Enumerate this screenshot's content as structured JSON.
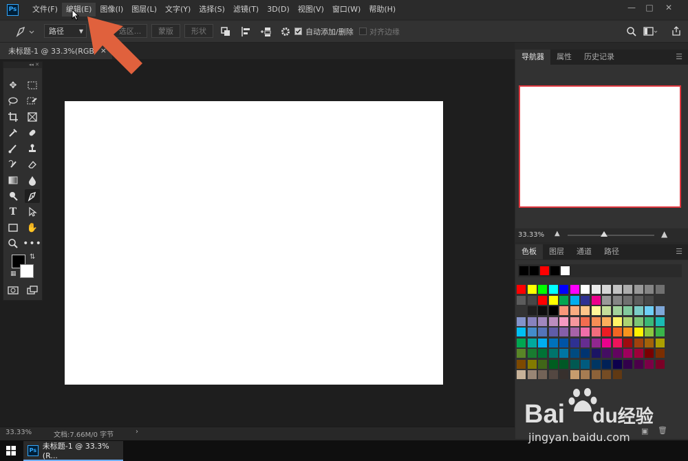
{
  "app": {
    "logo": "Ps"
  },
  "menu": [
    "文件(F)",
    "编辑(E)",
    "图像(I)",
    "图层(L)",
    "文字(Y)",
    "选择(S)",
    "滤镜(T)",
    "3D(D)",
    "视图(V)",
    "窗口(W)",
    "帮助(H)"
  ],
  "options": {
    "pen_mode": "路径",
    "make_selection": "选区...",
    "mask": "蒙版",
    "shape": "形状",
    "auto_add_delete": "自动添加/删除",
    "align_edges": "对齐边缘"
  },
  "document": {
    "tab_title": "未标题-1 @ 33.3%(RGB",
    "close": "×",
    "zoom": "33.33%",
    "doc_info": "文档:7.66M/0 字节",
    "status_arrow": "›"
  },
  "navigator": {
    "tabs": [
      "导航器",
      "属性",
      "历史记录"
    ],
    "zoom": "33.33%"
  },
  "swatches_panel": {
    "tabs": [
      "色板",
      "图层",
      "通道",
      "路径"
    ],
    "recent": [
      "#000000",
      "#000000",
      "#ff0000",
      "#000000",
      "#ffffff"
    ],
    "grid": [
      [
        "#ff0000",
        "#ffff00",
        "#00ff00",
        "#00ffff",
        "#0000ff",
        "#ff00ff",
        "#ffffff",
        "#ebebeb",
        "#d6d6d6",
        "#c2c2c2",
        "#adadad",
        "#999999",
        "#858585",
        "#707070"
      ],
      [
        "#5c5c5c",
        "#474747",
        "#ff0000",
        "#ffff00",
        "#00a651",
        "#00aeef",
        "#2e3192",
        "#ec008c",
        "#999999",
        "#858585",
        "#707070",
        "#5c5c5c",
        "#474747",
        "#333333"
      ],
      [
        "#333333",
        "#1f1f1f",
        "#0d0d0d",
        "#000000",
        "#f7977a",
        "#f9ad81",
        "#fdc68a",
        "#fff79a",
        "#c4df9b",
        "#a3d39c",
        "#82ca9d",
        "#7bcdc8",
        "#6ecff6",
        "#7ea7d8"
      ],
      [
        "#8493ca",
        "#8882be",
        "#a187be",
        "#bc8dbf",
        "#f49ac2",
        "#f6989d",
        "#f26c4f",
        "#f68e55",
        "#fbaf5c",
        "#fff467",
        "#acd372",
        "#7cc576",
        "#3bb878",
        "#1abbb4"
      ],
      [
        "#00bff3",
        "#438ccb",
        "#5574b9",
        "#605ca8",
        "#855fa8",
        "#a763a8",
        "#f06ea9",
        "#f26d7d",
        "#ed1c24",
        "#f26522",
        "#f7941d",
        "#fff200",
        "#8dc73f",
        "#39b54a"
      ],
      [
        "#00a651",
        "#00a99d",
        "#00aeef",
        "#0072bc",
        "#0054a6",
        "#2e3192",
        "#662d91",
        "#92278f",
        "#ec008c",
        "#ed145b",
        "#9e0b0f",
        "#a0410d",
        "#a36209",
        "#aba000"
      ],
      [
        "#598527",
        "#197b30",
        "#007236",
        "#00746b",
        "#0076a3",
        "#004b80",
        "#003471",
        "#1b1464",
        "#440e62",
        "#630460",
        "#9e005d",
        "#9e0039",
        "#790000",
        "#7b2e00"
      ],
      [
        "#7d4900",
        "#827b00",
        "#406618",
        "#005e20",
        "#005826",
        "#005952",
        "#005b7f",
        "#003663",
        "#002157",
        "#0d004c",
        "#32004b",
        "#4b0049",
        "#7b0046",
        "#7a0026"
      ],
      [
        "#c7b299",
        "#998675",
        "#736357",
        "#534741",
        "#37302d",
        "#c69c6d",
        "#a67c52",
        "#8c6239",
        "#754c24",
        "#603913"
      ]
    ]
  },
  "taskbar": {
    "app_title": "未标题-1 @ 33.3%(R..."
  },
  "watermark": {
    "line1": "Bai",
    "line2": "du",
    "line3": "经验",
    "url": "jingyan.baidu.com"
  },
  "colors": {
    "accent": "#31a8ff",
    "annotation": "#e0613d",
    "nav_frame": "#e0373f"
  }
}
